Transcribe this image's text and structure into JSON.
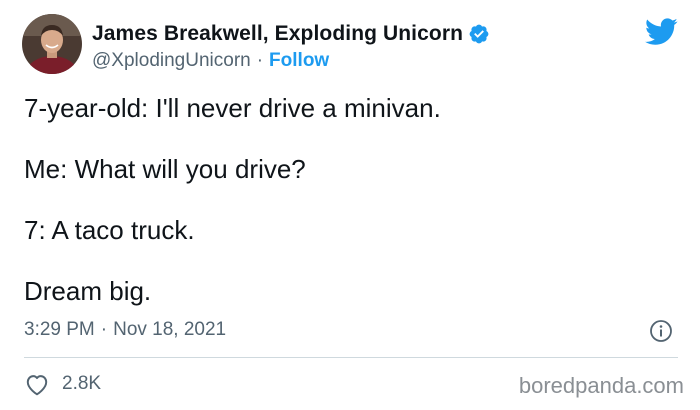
{
  "author": {
    "display_name": "James Breakwell, Exploding Unicorn",
    "handle": "@XplodingUnicorn",
    "separator": "·",
    "follow_label": "Follow",
    "verified": true
  },
  "tweet": {
    "lines": [
      "7-year-old: I'll never drive a minivan.",
      "Me: What will you drive?",
      "7: A taco truck.",
      "Dream big."
    ],
    "time": "3:29 PM",
    "date": "Nov 18, 2021"
  },
  "actions": {
    "like_count": "2.8K"
  },
  "watermark": "boredpanda.com",
  "icons": {
    "bird": "twitter-bird-icon",
    "verified": "verified-badge-icon",
    "info": "info-icon",
    "like": "heart-icon"
  },
  "colors": {
    "twitter_blue": "#1d9bf0",
    "text_primary": "#0f1419",
    "text_secondary": "#536471",
    "divider": "#cfd9de"
  }
}
